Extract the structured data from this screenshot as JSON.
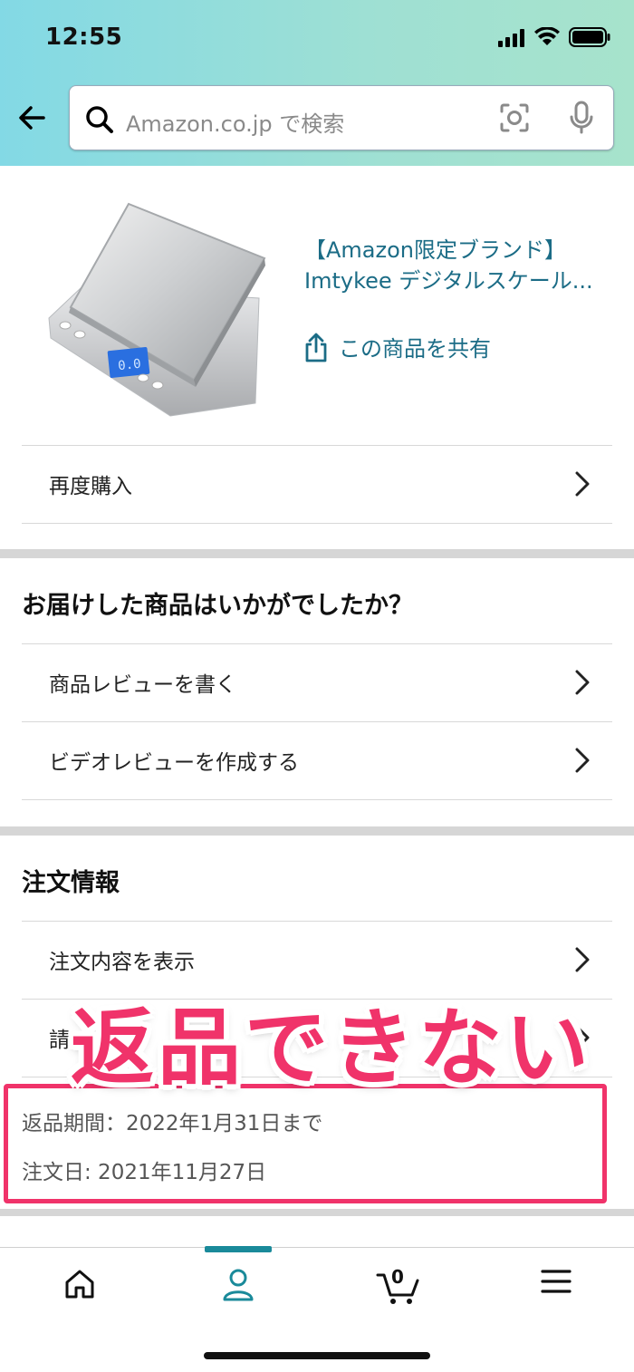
{
  "status": {
    "time": "12:55"
  },
  "search": {
    "placeholder": "Amazon.co.jp で検索"
  },
  "product": {
    "title": "【Amazon限定ブランド】Imtykee デジタルスケール...",
    "share_label": "この商品を共有"
  },
  "rebuy": {
    "label": "再度購入"
  },
  "review_section": {
    "heading": "お届けした商品はいかがでしたか？",
    "items": [
      {
        "label": "商品レビューを書く"
      },
      {
        "label": "ビデオレビューを作成する"
      }
    ]
  },
  "order_section": {
    "heading": "注文情報",
    "items": [
      {
        "label": "注文内容を表示"
      },
      {
        "label": "請"
      }
    ],
    "return_period": "返品期間：2022年1月31日まで",
    "order_date": "注文日: 2021年11月27日"
  },
  "annotation": {
    "overlay_text": "返品できない",
    "color": "#f0336a"
  },
  "bottom_nav": {
    "tabs": [
      {
        "icon": "home-icon"
      },
      {
        "icon": "account-icon",
        "active": true
      },
      {
        "icon": "cart-icon"
      },
      {
        "icon": "menu-icon"
      }
    ],
    "cart_count": "0"
  },
  "colors": {
    "link": "#1b6c86",
    "accent": "#1a8a9a",
    "header_gradient_start": "#83d9e5",
    "header_gradient_end": "#a7e3cc"
  }
}
